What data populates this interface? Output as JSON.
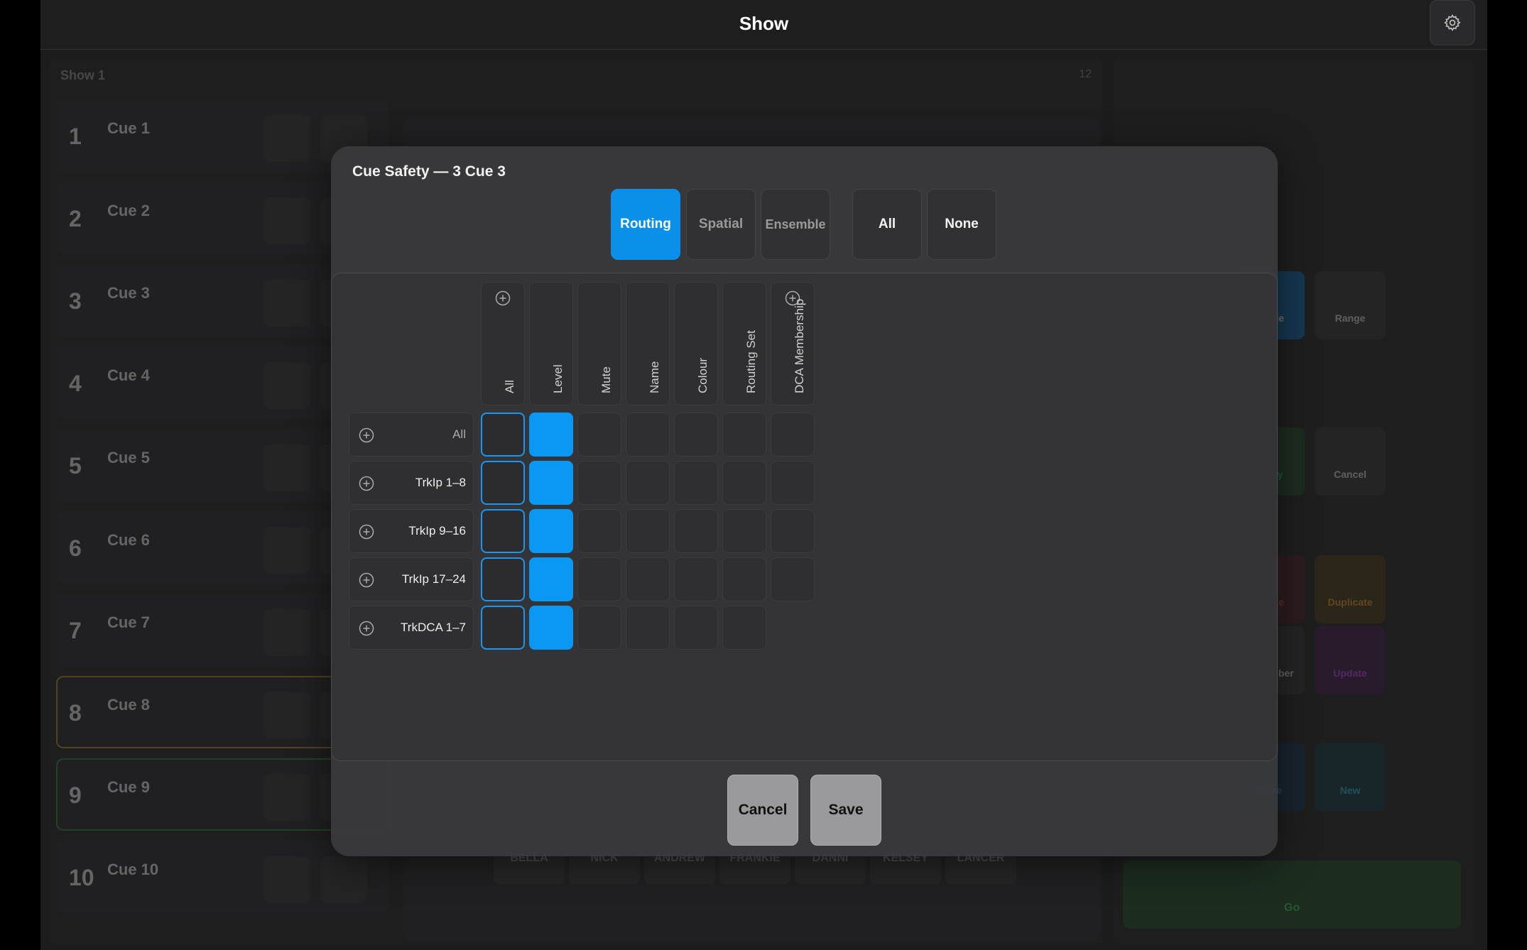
{
  "header": {
    "title": "Show"
  },
  "background": {
    "show_name": "Show 1",
    "cues": [
      {
        "num": "1",
        "name": "Cue 1"
      },
      {
        "num": "2",
        "name": "Cue 2"
      },
      {
        "num": "3",
        "name": "Cue 3"
      },
      {
        "num": "4",
        "name": "Cue 4"
      },
      {
        "num": "5",
        "name": "Cue 5"
      },
      {
        "num": "6",
        "name": "Cue 6"
      },
      {
        "num": "7",
        "name": "Cue 7"
      },
      {
        "num": "8",
        "name": "Cue 8"
      },
      {
        "num": "9",
        "name": "Cue 9"
      },
      {
        "num": "10",
        "name": "Cue 10"
      }
    ],
    "actors": [
      "BELLA",
      "NICK",
      "ANDREW",
      "FRANKIE",
      "DANNI",
      "KELSEY",
      "LANCER"
    ],
    "side": {
      "single": "Single",
      "range": "Range",
      "apply": "Apply",
      "cancel": "Cancel",
      "delete": "Delete",
      "duplicate": "Duplicate",
      "renumber": "Renumber",
      "update": "Update",
      "store": "Store",
      "new": "New",
      "go": "Go"
    }
  },
  "modal": {
    "title": "Cue Safety — 3  Cue 3",
    "tabs": [
      {
        "label": "Routing",
        "active": true
      },
      {
        "label": "Spatial",
        "active": false
      },
      {
        "label": "Ensemble",
        "active": false
      }
    ],
    "all_label": "All",
    "none_label": "None",
    "columns": [
      "All",
      "Level",
      "Mute",
      "Name",
      "Colour",
      "Routing Set",
      "DCA Membership"
    ],
    "rows": [
      {
        "label": "All",
        "cells": [
          "outline",
          "on",
          "off",
          "off",
          "off",
          "off",
          "off"
        ]
      },
      {
        "label": "TrkIp 1–8",
        "cells": [
          "outline",
          "on",
          "off",
          "off",
          "off",
          "off",
          "off"
        ]
      },
      {
        "label": "TrkIp 9–16",
        "cells": [
          "outline",
          "on",
          "off",
          "off",
          "off",
          "off",
          "off"
        ]
      },
      {
        "label": "TrkIp 17–24",
        "cells": [
          "outline",
          "on",
          "off",
          "off",
          "off",
          "off",
          "off"
        ]
      },
      {
        "label": "TrkDCA 1–7",
        "cells": [
          "outline",
          "on",
          "off",
          "off",
          "off",
          "off",
          null
        ]
      }
    ],
    "cancel_label": "Cancel",
    "save_label": "Save"
  },
  "colors": {
    "accent": "#0a98f5",
    "modal_bg": "#3a3a3c"
  },
  "icons": {
    "settings": "gear-icon",
    "add": "plus-circle-icon"
  }
}
